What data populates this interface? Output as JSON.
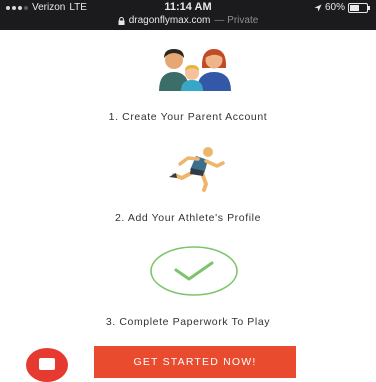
{
  "status_bar": {
    "carrier": "Verizon",
    "network": "LTE",
    "time": "11:14 AM",
    "url": "dragonflymax.com",
    "mode": "— Private",
    "battery": "60%"
  },
  "steps": [
    {
      "label": "1. Create Your Parent Account",
      "icon": "family-icon"
    },
    {
      "label": "2. Add Your Athlete's Profile",
      "icon": "runner-icon"
    },
    {
      "label": "3. Complete Paperwork To Play",
      "icon": "checkmark-circle-icon"
    }
  ],
  "cta": {
    "label": "GET STARTED NOW!"
  },
  "colors": {
    "accent": "#e94b2e",
    "check": "#7cc46a",
    "status_bg": "#1b1b1d"
  }
}
